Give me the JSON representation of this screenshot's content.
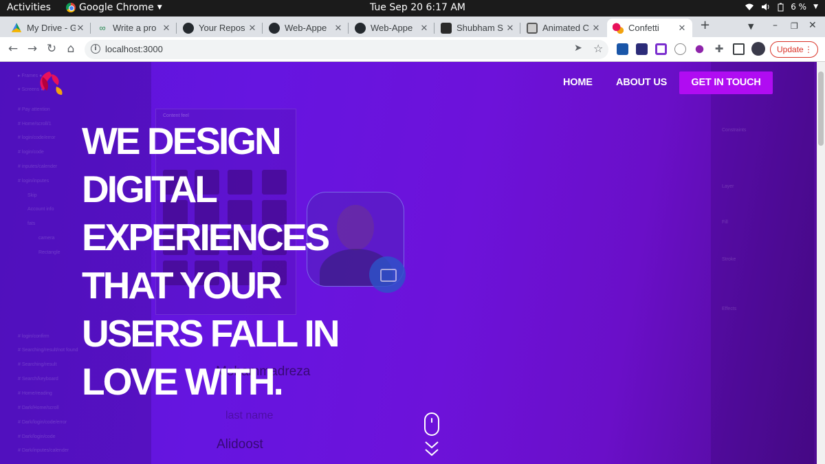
{
  "system_bar": {
    "activities": "Activities",
    "app_name": "Google Chrome",
    "clock": "Tue Sep 20  6:17 AM",
    "battery": "6 %"
  },
  "tabs": [
    {
      "title": "My Drive - G",
      "icon": "google-drive-icon",
      "active": false
    },
    {
      "title": "Write a pro",
      "icon": "codepen-icon",
      "active": false
    },
    {
      "title": "Your Repos",
      "icon": "github-icon",
      "active": false
    },
    {
      "title": "Web-Appe",
      "icon": "github-icon",
      "active": false
    },
    {
      "title": "Web-Appe",
      "icon": "github-icon",
      "active": false
    },
    {
      "title": "Shubham S",
      "icon": "video-icon",
      "active": false
    },
    {
      "title": "Animated C",
      "icon": "image-icon",
      "active": false
    },
    {
      "title": "Confetti",
      "icon": "confetti-icon",
      "active": true
    }
  ],
  "toolbar": {
    "url": "localhost:3000",
    "update_label": "Update"
  },
  "site": {
    "nav": {
      "home": "HOME",
      "about": "ABOUT US",
      "cta": "GET IN TOUCH"
    },
    "hero_lines": [
      "WE DESIGN",
      "DIGITAL",
      "EXPERIENCES",
      "THAT YOUR",
      "USERS FALL IN",
      "LOVE WITH."
    ],
    "background_ghost": {
      "content_feel": "Content feel",
      "first_name_value": "Mohammadreza",
      "last_name_label": "last name",
      "last_name_value": "Alidoost"
    }
  },
  "colors": {
    "page_gradient_start": "#5c14d9",
    "page_gradient_end": "#4c0a8e",
    "cta": "#b00cf2",
    "update_red": "#d93025"
  }
}
